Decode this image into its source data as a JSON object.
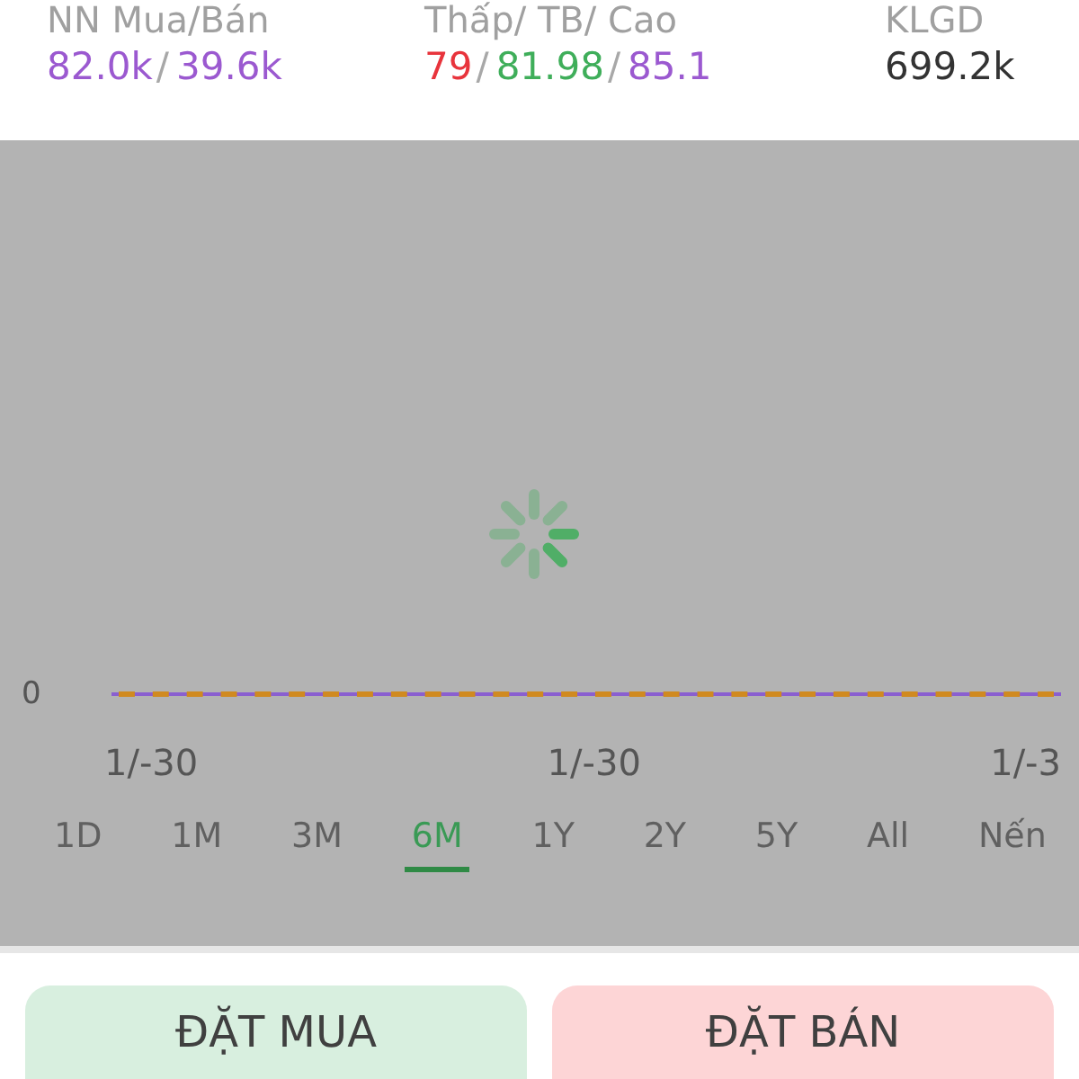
{
  "stats": [
    {
      "label": "NN Mua/Bán",
      "separator": "/",
      "values": [
        {
          "text": "82.0k",
          "color": "#9b59d0"
        },
        {
          "text": "39.6k",
          "color": "#9b59d0"
        }
      ]
    },
    {
      "label": "Thấp/ TB/ Cao",
      "separator": "/",
      "values": [
        {
          "text": "79",
          "color": "#e8343c"
        },
        {
          "text": "81.98",
          "color": "#3fae5a"
        },
        {
          "text": "85.1",
          "color": "#9b59d0"
        }
      ]
    },
    {
      "label": "KLGD",
      "values": [
        {
          "text": "699.2k",
          "color": "#333333"
        }
      ]
    }
  ],
  "chart": {
    "loading": true,
    "y_axis_label": "0",
    "x_axis_labels": [
      "1/-30",
      "1/-30",
      "1/-3"
    ]
  },
  "ranges": [
    {
      "label": "1D",
      "selected": false
    },
    {
      "label": "1M",
      "selected": false
    },
    {
      "label": "3M",
      "selected": false
    },
    {
      "label": "6M",
      "selected": true
    },
    {
      "label": "1Y",
      "selected": false
    },
    {
      "label": "2Y",
      "selected": false
    },
    {
      "label": "5Y",
      "selected": false
    },
    {
      "label": "All",
      "selected": false
    },
    {
      "label": "Nến",
      "selected": false
    }
  ],
  "actions": [
    {
      "label": "ĐẶT MUA",
      "kind": "buy"
    },
    {
      "label": "ĐẶT BÁN",
      "kind": "sell"
    }
  ]
}
